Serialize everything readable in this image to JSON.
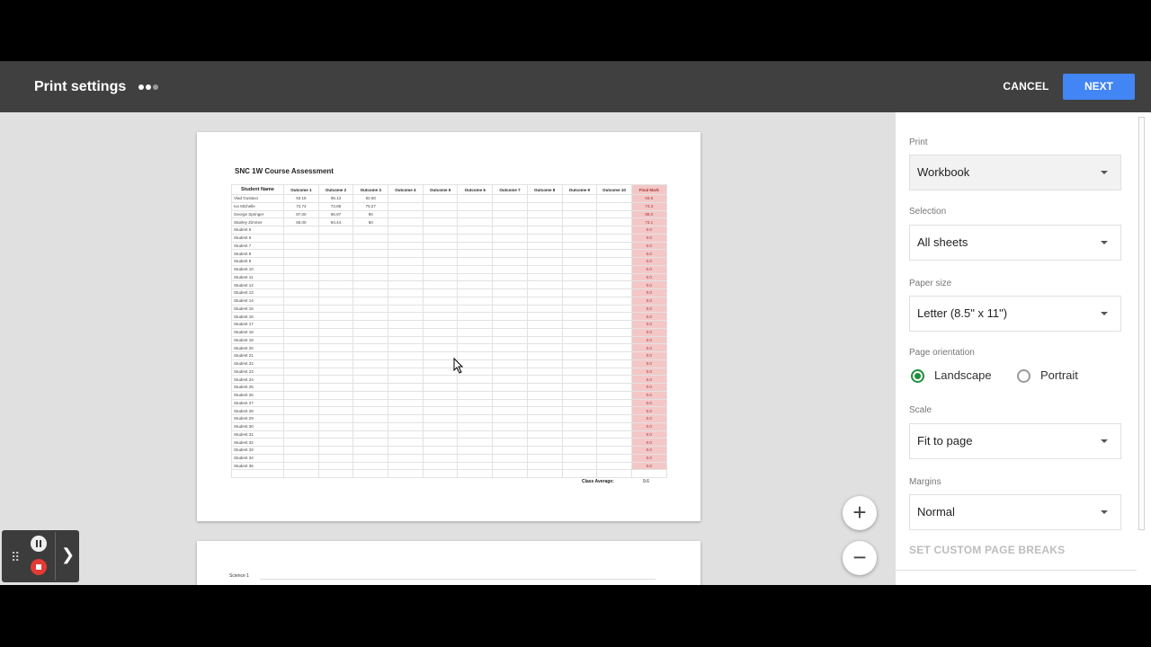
{
  "header": {
    "title": "Print settings",
    "cancel_label": "CANCEL",
    "next_label": "NEXT"
  },
  "sheet": {
    "title": "SNC 1W Course Assessment",
    "columns": [
      "Student Name",
      "Outcome 1",
      "Outcome 2",
      "Outcome 3",
      "Outcome 4",
      "Outcome 5",
      "Outcome 6",
      "Outcome 7",
      "Outcome 8",
      "Outcome 9",
      "Outcome 10",
      "Final Mark"
    ],
    "rows": [
      [
        "Vlad Gustavo",
        "93.18",
        "95.13",
        "92.60",
        "93.6"
      ],
      [
        "Ivo Michelle",
        "72.74",
        "73.88",
        "75.27",
        "74.3"
      ],
      [
        "George Springer",
        "87.00",
        "86.97",
        "90",
        "88.0"
      ],
      [
        "Stanley Zimmer",
        "65.00",
        "84.44",
        "60",
        "73.1"
      ],
      [
        "Student 5",
        "",
        "",
        "",
        "0.0"
      ],
      [
        "Student 6",
        "",
        "",
        "",
        "0.0"
      ],
      [
        "Student 7",
        "",
        "",
        "",
        "0.0"
      ],
      [
        "Student 8",
        "",
        "",
        "",
        "0.0"
      ],
      [
        "Student 9",
        "",
        "",
        "",
        "0.0"
      ],
      [
        "Student 10",
        "",
        "",
        "",
        "0.0"
      ],
      [
        "Student 11",
        "",
        "",
        "",
        "0.0"
      ],
      [
        "Student 12",
        "",
        "",
        "",
        "0.0"
      ],
      [
        "Student 13",
        "",
        "",
        "",
        "0.0"
      ],
      [
        "Student 14",
        "",
        "",
        "",
        "0.0"
      ],
      [
        "Student 15",
        "",
        "",
        "",
        "0.0"
      ],
      [
        "Student 16",
        "",
        "",
        "",
        "0.0"
      ],
      [
        "Student 17",
        "",
        "",
        "",
        "0.0"
      ],
      [
        "Student 18",
        "",
        "",
        "",
        "0.0"
      ],
      [
        "Student 19",
        "",
        "",
        "",
        "0.0"
      ],
      [
        "Student 20",
        "",
        "",
        "",
        "0.0"
      ],
      [
        "Student 21",
        "",
        "",
        "",
        "0.0"
      ],
      [
        "Student 22",
        "",
        "",
        "",
        "0.0"
      ],
      [
        "Student 23",
        "",
        "",
        "",
        "0.0"
      ],
      [
        "Student 24",
        "",
        "",
        "",
        "0.0"
      ],
      [
        "Student 25",
        "",
        "",
        "",
        "0.0"
      ],
      [
        "Student 26",
        "",
        "",
        "",
        "0.0"
      ],
      [
        "Student 27",
        "",
        "",
        "",
        "0.0"
      ],
      [
        "Student 28",
        "",
        "",
        "",
        "0.0"
      ],
      [
        "Student 29",
        "",
        "",
        "",
        "0.0"
      ],
      [
        "Student 30",
        "",
        "",
        "",
        "0.0"
      ],
      [
        "Student 31",
        "",
        "",
        "",
        "0.0"
      ],
      [
        "Student 32",
        "",
        "",
        "",
        "0.0"
      ],
      [
        "Student 33",
        "",
        "",
        "",
        "0.0"
      ],
      [
        "Student 34",
        "",
        "",
        "",
        "0.0"
      ],
      [
        "Student 35",
        "",
        "",
        "",
        "0.0"
      ]
    ],
    "class_average_label": "Class Average:",
    "class_average_value": "9.6",
    "page2_label": "Science 1"
  },
  "settings": {
    "print": {
      "label": "Print",
      "value": "Workbook"
    },
    "selection": {
      "label": "Selection",
      "value": "All sheets"
    },
    "paper_size": {
      "label": "Paper size",
      "value": "Letter (8.5\" x 11\")"
    },
    "orientation": {
      "label": "Page orientation",
      "options": [
        "Landscape",
        "Portrait"
      ],
      "selected": "Landscape"
    },
    "scale": {
      "label": "Scale",
      "value": "Fit to page"
    },
    "margins": {
      "label": "Margins",
      "value": "Normal"
    },
    "custom_breaks_label": "SET CUSTOM PAGE BREAKS"
  },
  "zoom": {
    "in_label": "+",
    "out_label": "−"
  },
  "colors": {
    "header_bg": "#404040",
    "accent": "#4285f4",
    "radio_on": "#1e8e3e",
    "final_mark_bg": "#f4c7c7"
  },
  "icons": {
    "dropdown": "caret-down-icon",
    "zoom_in": "plus-icon",
    "zoom_out": "minus-icon",
    "pause": "pause-icon",
    "stop": "stop-icon",
    "expand": "chevron-right-icon",
    "grip": "drag-handle-icon"
  }
}
